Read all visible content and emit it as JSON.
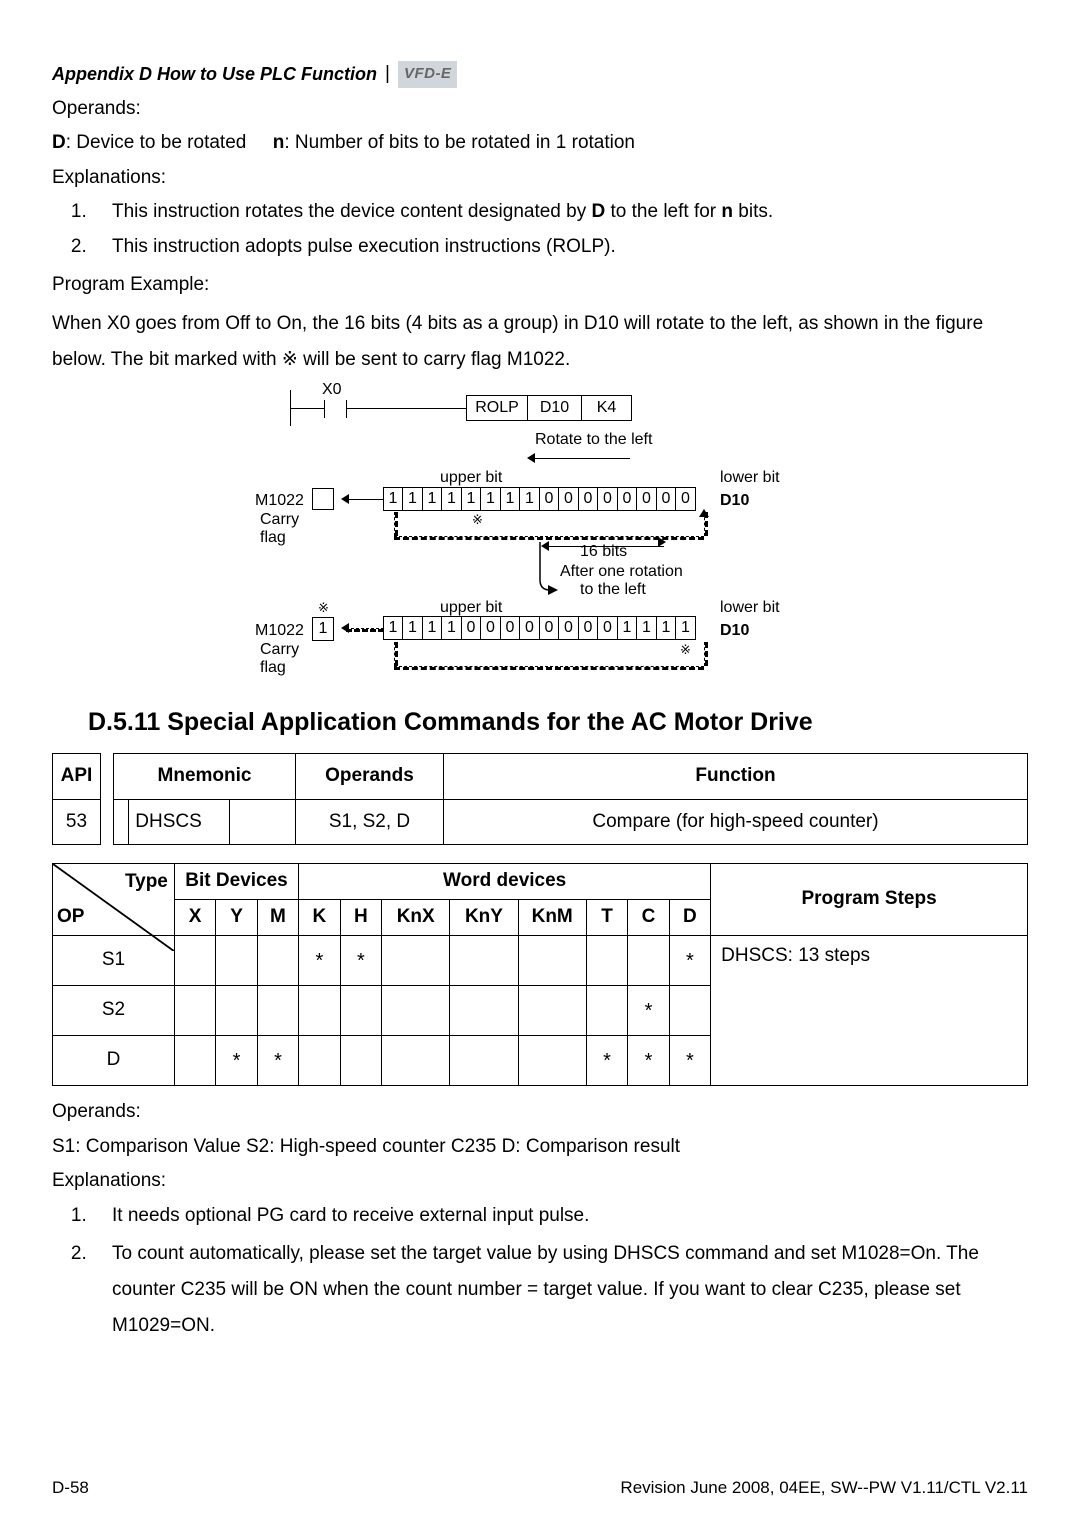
{
  "header": {
    "appendix": "Appendix D How to Use PLC Function",
    "bar": "|",
    "logo": "VFD-E"
  },
  "sec1": {
    "operands_h": "Operands:",
    "operands_line_D": "D",
    "operands_line_D_txt": ": Device to be rotated",
    "operands_line_n": "n",
    "operands_line_n_txt": ": Number of bits to be rotated in 1 rotation",
    "expl_h": "Explanations:",
    "li1a": "This instruction rotates the device content designated by ",
    "li1b": "D",
    "li1c": " to the left for ",
    "li1d": "n",
    "li1e": " bits.",
    "li2": "This instruction adopts pulse execution instructions (ROLP).",
    "pe_h": "Program Example:",
    "pe_p": "When X0 goes from Off to On, the 16 bits (4 bits as a group) in D10 will rotate to the left, as shown in the figure below. The bit marked with ※ will be sent to carry flag M1022."
  },
  "fig": {
    "x0": "X0",
    "rolp": "ROLP",
    "d10": "D10",
    "k4": "K4",
    "rot": "Rotate to the left",
    "upper": "upper bit",
    "lower": "lower bit",
    "m1022": "M1022",
    "carry": "Carry",
    "flag": "flag",
    "bits16": "16 bits",
    "after1": "After one rotation",
    "after2": "to the left",
    "d10lab": "D10",
    "row_top": [
      "1",
      "1",
      "1",
      "1",
      "1",
      "1",
      "1",
      "1",
      "0",
      "0",
      "0",
      "0",
      "0",
      "0",
      "0",
      "0"
    ],
    "row_bot": [
      "1",
      "1",
      "1",
      "1",
      "0",
      "0",
      "0",
      "0",
      "0",
      "0",
      "0",
      "0",
      "1",
      "1",
      "1",
      "1"
    ],
    "one": "1"
  },
  "h2": "D.5.11 Special Application Commands for the AC Motor Drive",
  "t1": {
    "api": "API",
    "mn": "Mnemonic",
    "op": "Operands",
    "fn": "Function",
    "r_api": "53",
    "r_mn": "DHSCS",
    "r_op": "S1, S2, D",
    "r_fn": "Compare (for high-speed counter)"
  },
  "t2": {
    "type": "Type",
    "op": "OP",
    "bit": "Bit Devices",
    "word": "Word devices",
    "ps": "Program Steps",
    "cols": [
      "X",
      "Y",
      "M",
      "K",
      "H",
      "KnX",
      "KnY",
      "KnM",
      "T",
      "C",
      "D"
    ],
    "rows": [
      {
        "name": "S1",
        "cells": [
          "",
          "",
          "",
          "*",
          "*",
          "",
          "",
          "",
          "",
          "",
          "*"
        ]
      },
      {
        "name": "S2",
        "cells": [
          "",
          "",
          "",
          "",
          "",
          "",
          "",
          "",
          "",
          "*",
          ""
        ]
      },
      {
        "name": "D",
        "cells": [
          "",
          "*",
          "*",
          "",
          "",
          "",
          "",
          "",
          "*",
          "*",
          "*"
        ]
      }
    ],
    "steps": "DHSCS: 13 steps"
  },
  "sec2": {
    "operands_h": "Operands:",
    "operands_line": "S1: Comparison Value  S2: High-speed counter C235  D: Comparison result",
    "expl_h": "Explanations:",
    "li1": "It needs optional PG card to receive external input pulse.",
    "li2": "To count automatically, please set the target value by using DHSCS command and set M1028=On. The counter C235 will be ON when the count number = target value. If you want to clear C235, please set M1029=ON."
  },
  "footer": {
    "left": "D-58",
    "right": "Revision June 2008, 04EE, SW--PW V1.11/CTL V2.11"
  }
}
